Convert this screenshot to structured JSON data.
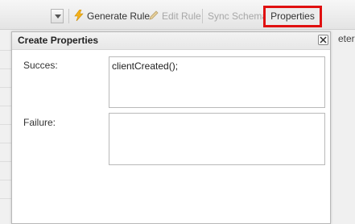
{
  "toolbar": {
    "generate_rule": "Generate Rule",
    "edit_rule": "Edit Rule",
    "sync_schema": "Sync Schema",
    "properties": "Properties"
  },
  "background": {
    "overflow_text": "eter"
  },
  "dialog": {
    "title": "Create Properties",
    "success_label": "Succes:",
    "success_value": "clientCreated();",
    "failure_label": "Failure:",
    "failure_value": ""
  }
}
